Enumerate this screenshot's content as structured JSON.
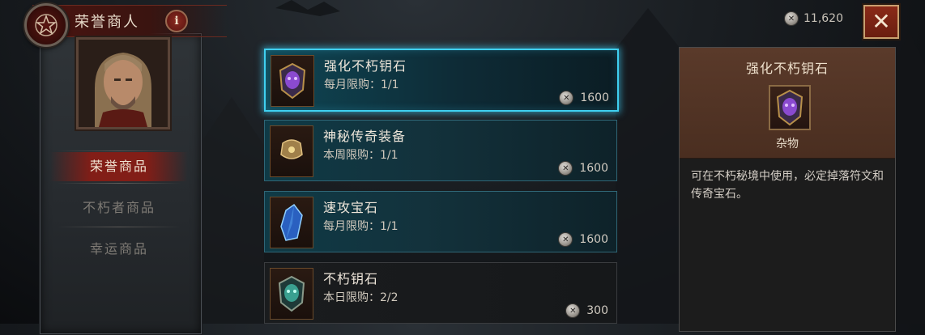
{
  "header": {
    "title": "荣誉商人",
    "info_label": "i",
    "currency_value": "11,620",
    "close_label": "✕"
  },
  "sidebar": {
    "items": [
      {
        "label": "荣誉商品",
        "active": true
      },
      {
        "label": "不朽者商品",
        "active": false
      },
      {
        "label": "幸运商品",
        "active": false
      }
    ]
  },
  "shop": {
    "items": [
      {
        "name": "强化不朽钥石",
        "limit": "每月限购：1/1",
        "price": "1600"
      },
      {
        "name": "神秘传奇装备",
        "limit": "本周限购：1/1",
        "price": "1600"
      },
      {
        "name": "速攻宝石",
        "limit": "每月限购：1/1",
        "price": "1600"
      },
      {
        "name": "不朽钥石",
        "limit": "本日限购：2/2",
        "price": "300"
      }
    ]
  },
  "detail": {
    "title": "强化不朽钥石",
    "category": "杂物",
    "description": "可在不朽秘境中使用，必定掉落符文和传奇宝石。"
  },
  "colors": {
    "accent_blue": "#3fd0f0",
    "accent_red": "#8c1c14",
    "detail_header": "#5a3a2a"
  }
}
